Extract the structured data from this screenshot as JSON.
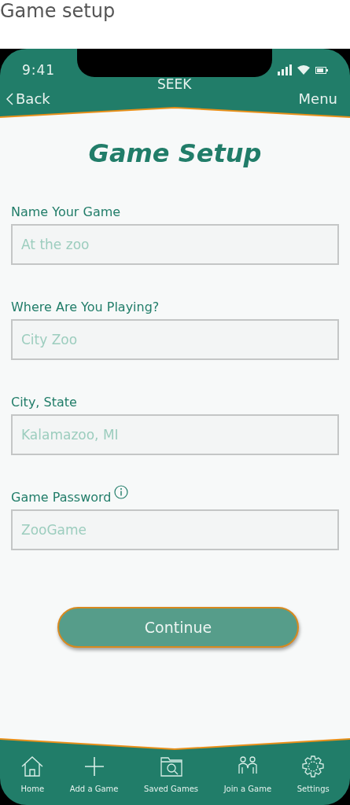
{
  "page_title": "Game setup",
  "status_bar": {
    "time": "9:41"
  },
  "nav": {
    "back": "Back",
    "title": "SEEK",
    "menu": "Menu"
  },
  "heading": "Game Setup",
  "fields": [
    {
      "label": "Name Your Game",
      "placeholder": "At the zoo",
      "info": false
    },
    {
      "label": "Where Are You Playing?",
      "placeholder": "City Zoo",
      "info": false
    },
    {
      "label": "City, State",
      "placeholder": "Kalamazoo, MI",
      "info": false
    },
    {
      "label": "Game Password",
      "placeholder": "ZooGame",
      "info": true
    }
  ],
  "continue_button": "Continue",
  "tab_bar": [
    {
      "kind": "home",
      "label": "Home"
    },
    {
      "kind": "add",
      "label": "Add a Game"
    },
    {
      "kind": "folder",
      "label": "Saved Games"
    },
    {
      "kind": "people",
      "label": "Join a Game"
    },
    {
      "kind": "settings",
      "label": "Settings"
    }
  ]
}
